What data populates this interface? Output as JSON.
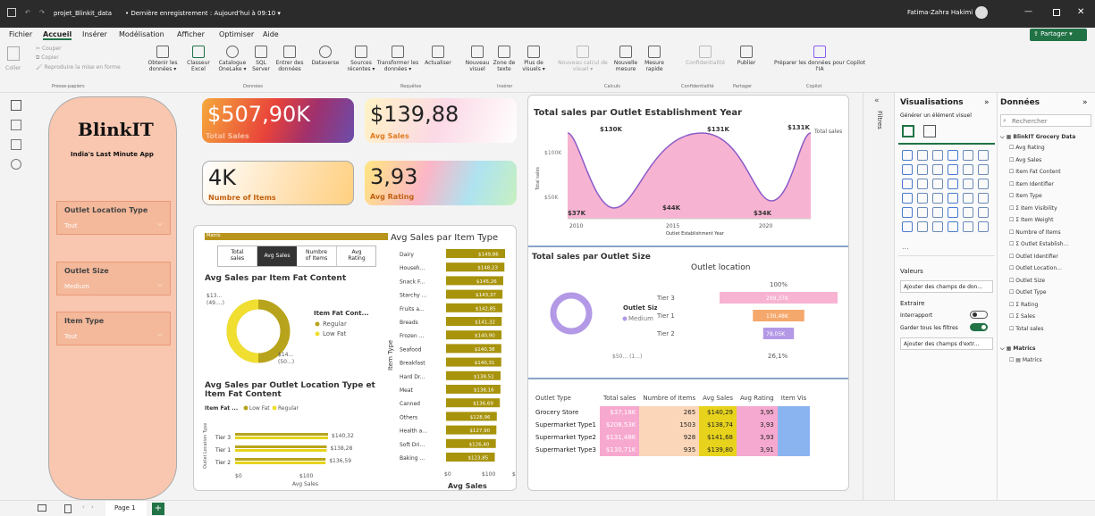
{
  "titlebar": {
    "filename": "projet_Blinkit_data",
    "status": "• Dernière enregistrement : Aujourd'hui à 09:10 ▾",
    "user": "Fatima-Zahra Hakimi"
  },
  "menu": [
    "Fichier",
    "Accueil",
    "Insérer",
    "Modélisation",
    "Afficher",
    "Optimiser",
    "Aide"
  ],
  "share_label": "Partager",
  "ribbon": {
    "clipboard": {
      "coller": "Coller",
      "couper": "Couper",
      "copier": "Copier",
      "reproduire": "Reproduire la mise en forme",
      "group": "Presse-papiers"
    },
    "data": [
      [
        "Obtenir les",
        "données ▾"
      ],
      [
        "Classeur",
        "Excel"
      ],
      [
        "Catalogue",
        "OneLake ▾"
      ],
      [
        "SQL",
        "Server"
      ],
      [
        "Entrer des",
        "données"
      ],
      [
        "Dataverse",
        ""
      ],
      [
        "Sources",
        "récentes ▾"
      ]
    ],
    "data_group": "Données",
    "requetes": [
      [
        "Transformer les",
        "données ▾"
      ],
      [
        "Actualiser",
        ""
      ]
    ],
    "requetes_group": "Requêtes",
    "inserer": [
      [
        "Nouveau",
        "visuel"
      ],
      [
        "Zone de",
        "texte"
      ],
      [
        "Plus de",
        "visuels ▾"
      ]
    ],
    "inserer_group": "Insérer",
    "calculs": [
      [
        "Nouveau calcul de",
        "visuel ▾"
      ],
      [
        "Nouvelle",
        "mesure"
      ],
      [
        "Mesure",
        "rapide"
      ]
    ],
    "calculs_group": "Calculs",
    "confidentialite": "Confidentialité",
    "conf_group": "Confidentialité",
    "publier": "Publier",
    "partager_group": "Partager",
    "copilot": [
      "Préparer les données pour Copilot",
      "l'IA"
    ],
    "copilot_group": "Copilot"
  },
  "brand": {
    "title": "BlinkIT",
    "subtitle": "India's Last Minute App"
  },
  "slicers": [
    {
      "label": "Outlet Location Type",
      "value": "Tout"
    },
    {
      "label": "Outlet Size",
      "value": "Medium"
    },
    {
      "label": "Item Type",
      "value": "Tout"
    }
  ],
  "kpis": [
    {
      "value": "$507,90K",
      "label": "Total Sales"
    },
    {
      "value": "$139,88",
      "label": "Avg Sales"
    },
    {
      "value": "4K",
      "label": "Numbre of Items"
    },
    {
      "value": "3,93",
      "label": "Avg Rating"
    }
  ],
  "matrix": {
    "tag": "Matrix",
    "buttons": [
      [
        "Total",
        "sales"
      ],
      [
        "Avg Sales",
        ""
      ],
      [
        "Numbre",
        "of Items"
      ],
      [
        "Avg",
        "Rating"
      ]
    ]
  },
  "donut": {
    "title": "Avg Sales par Item Fat Content",
    "legend_title": "Item Fat Cont...",
    "regular": "Regular",
    "lowfat": "Low Fat",
    "label1": "$13...",
    "label1b": "(49....)",
    "label2": "$14...",
    "label2b": "(50...)"
  },
  "location_chart": {
    "title1": "Avg Sales par Outlet Location Type et",
    "title2": "Item Fat Content",
    "legend_title": "Item Fat ...",
    "legend_low": "Low Fat",
    "legend_reg": "Regular",
    "ylabel": "Outlet Location Type",
    "xlabel": "Avg Sales",
    "x0": "$0",
    "x1": "$100"
  },
  "chart_data": [
    {
      "type": "bar",
      "title": "Avg Sales par Item Type",
      "ylabel": "Item Type",
      "xlabel": "Avg Sales",
      "categories": [
        "Dairy",
        "Househ...",
        "Snack F...",
        "Starchy ...",
        "Fruits a...",
        "Breads",
        "Frozen ...",
        "Seafood",
        "Breakfast",
        "Hard Dr...",
        "Meat",
        "Canned",
        "Others",
        "Health a...",
        "Soft Dri...",
        "Baking ..."
      ],
      "values": [
        149.86,
        148.23,
        145.26,
        143.37,
        142.85,
        141.32,
        140.9,
        140.38,
        140.31,
        138.51,
        138.16,
        136.69,
        128.96,
        127.9,
        126.4,
        123.85
      ],
      "labels": [
        "$149,86",
        "$148,23",
        "$145,26",
        "$143,37",
        "$142,85",
        "$141,32",
        "$140,90",
        "$140,38",
        "$140,31",
        "$138,51",
        "$138,16",
        "$136,69",
        "$128,96",
        "$127,90",
        "$126,40",
        "$123,85"
      ],
      "ticks": [
        "$0",
        "$100",
        "$2"
      ]
    },
    {
      "type": "bar",
      "title": "Avg Sales par Outlet Location Type et Item Fat Content",
      "categories": [
        "Tier 3",
        "Tier 1",
        "Tier 2"
      ],
      "values": [
        140.32,
        138.28,
        136.59
      ],
      "labels": [
        "$140,32",
        "$138,28",
        "$136,59"
      ]
    },
    {
      "type": "area",
      "title": "Total sales par Outlet Establishment Year",
      "xlabel": "Outlet Establishment Year",
      "ylabel": "Total sales",
      "legend": "Total sales",
      "yticks": [
        "$100K",
        "$50K"
      ],
      "xticks": [
        "2010",
        "2015",
        "2020"
      ],
      "peaks": [
        {
          "label": "$130K"
        },
        {
          "label": "$37K"
        },
        {
          "label": "$131K"
        },
        {
          "label": "$44K"
        },
        {
          "label": "$131K"
        },
        {
          "label": "$34K"
        }
      ]
    },
    {
      "type": "pie",
      "title": "Total sales par Outlet Size",
      "legend_title": "Outlet Size",
      "legend_item": "Medium",
      "label": "$50... (1...)"
    },
    {
      "type": "bar",
      "title": "Outlet location",
      "categories": [
        "Tier 3",
        "Tier 1",
        "Tier 2"
      ],
      "values": [
        299.37,
        130.48,
        78.05
      ],
      "labels": [
        "299,37K",
        "130,48K",
        "78,05K"
      ],
      "top_pct": "100%",
      "bottom_pct": "26,1%"
    }
  ],
  "outlet_table": {
    "headers": [
      "Outlet Type",
      "Total sales",
      "Numbre of Items",
      "Avg Sales",
      "Avg Rating",
      "Item Vis"
    ],
    "rows": [
      [
        "Grocery Store",
        "$37,18K",
        "265",
        "$140,29",
        "3,95"
      ],
      [
        "Supermarket Type1",
        "$208,53K",
        "1503",
        "$138,74",
        "3,93"
      ],
      [
        "Supermarket Type2",
        "$131,48K",
        "928",
        "$141,68",
        "3,93"
      ],
      [
        "Supermarket Type3",
        "$130,71K",
        "935",
        "$139,80",
        "3,91"
      ]
    ]
  },
  "filters_label": "Filtres",
  "visualisations": {
    "title": "Visualisations",
    "generate": "Générer un élément visuel",
    "valeurs": "Valeurs",
    "ajouter": "Ajouter des champs de don...",
    "extraire": "Extraire",
    "interrapport": "Interrapport",
    "garder": "Garder tous les filtres",
    "ajouter2": "Ajouter des champs d'extr...",
    "dots": "..."
  },
  "donnees": {
    "title": "Données",
    "search": "Rechercher",
    "table": "BlinkIT Grocery Data",
    "fields": [
      "Avg Rating",
      "Avg Sales",
      "Item Fat Content",
      "Item Identifier",
      "Item Type",
      "Σ Item Visibility",
      "Σ Item Weight",
      "Numbre of Items",
      "Σ Outlet Establish...",
      "Outlet Identifier",
      "Outlet Location...",
      "Outlet Size",
      "Outlet Type",
      "Σ Rating",
      "Σ Sales",
      "Total sales"
    ],
    "matrics": "Matrics",
    "matrics_item": "Matrics"
  },
  "page": "Page 1"
}
